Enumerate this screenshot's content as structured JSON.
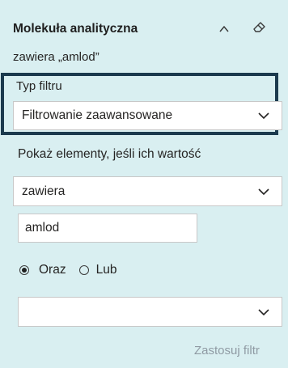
{
  "filter_card": {
    "title": "Molekuła analityczna",
    "summary": "zawiera „amlod”",
    "filter_type_label": "Typ filtru",
    "filter_type_value": "Filtrowanie zaawansowane",
    "show_items_label": "Pokaż elementy, jeśli ich wartość",
    "operator_value": "zawiera",
    "value_input": "amlod",
    "logic_and_label": "Oraz",
    "logic_or_label": "Lub",
    "logic_selected": "Oraz",
    "second_operator_value": "",
    "apply_label": "Zastosuj filtr"
  },
  "icons": {
    "collapse": "caret-up-icon",
    "clear": "eraser-icon",
    "dropdown": "chevron-down-icon"
  },
  "colors": {
    "panel_bg": "#d9eff1",
    "focus_border": "#1b3a4e",
    "disabled_text": "#8f9aa3"
  }
}
